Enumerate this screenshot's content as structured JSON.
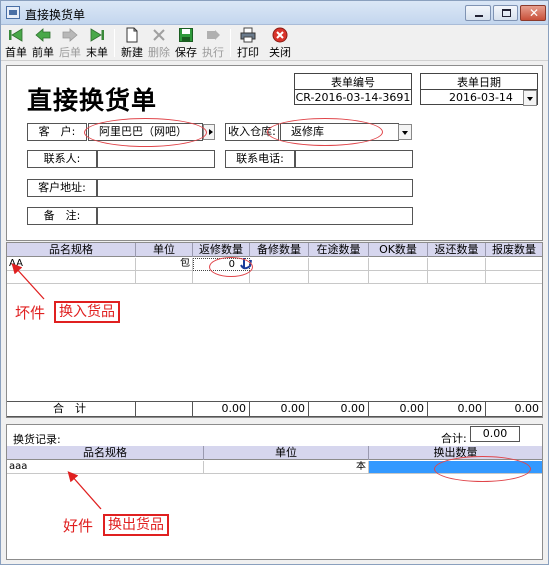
{
  "window": {
    "title": "直接换货单"
  },
  "toolbar": {
    "items": [
      {
        "label": "首单",
        "icon": "first-record-icon",
        "enabled": true
      },
      {
        "label": "前单",
        "icon": "previous-record-icon",
        "enabled": true
      },
      {
        "label": "后单",
        "icon": "next-record-icon",
        "enabled": false
      },
      {
        "label": "末单",
        "icon": "last-record-icon",
        "enabled": true
      },
      {
        "label": "新建",
        "icon": "new-document-icon",
        "enabled": true
      },
      {
        "label": "删除",
        "icon": "delete-icon",
        "enabled": false
      },
      {
        "label": "保存",
        "icon": "save-icon",
        "enabled": true
      },
      {
        "label": "执行",
        "icon": "execute-icon",
        "enabled": false
      },
      {
        "label": "打印",
        "icon": "print-icon",
        "enabled": true
      },
      {
        "label": "关闭",
        "icon": "close-icon",
        "enabled": true
      }
    ]
  },
  "doc": {
    "heading": "直接换货单",
    "number_label": "表单编号",
    "number_value": "CR-2016-03-14-3691",
    "date_label": "表单日期",
    "date_value": "2016-03-14"
  },
  "form": {
    "customer_label": "客　户:",
    "customer_value": "阿里巴巴（网吧）",
    "warehouse_label": "收入仓库:",
    "warehouse_value": "返修库",
    "contact_label": "联系人:",
    "contact_value": "",
    "phone_label": "联系电话:",
    "phone_value": "",
    "address_label": "客户地址:",
    "address_value": "",
    "remark_label": "备　注:",
    "remark_value": ""
  },
  "in_grid": {
    "columns": [
      "品名规格",
      "单位",
      "返修数量",
      "备修数量",
      "在途数量",
      "OK数量",
      "返还数量",
      "报废数量"
    ],
    "rows": [
      {
        "name": "AA",
        "unit": "包",
        "repair_qty": "0"
      }
    ],
    "totals_label": "合　计",
    "totals": [
      "0.00",
      "0.00",
      "0.00",
      "0.00",
      "0.00",
      "0.00"
    ]
  },
  "record": {
    "label": "换货记录:",
    "total_label": "合计:",
    "total_value": "0.00",
    "columns": [
      "品名规格",
      "单位",
      "换出数量"
    ],
    "rows": [
      {
        "name": "aaa",
        "unit": "本",
        "qty": ""
      }
    ]
  },
  "annotations": {
    "bad_prefix": "坏件",
    "bad_box": "换入货品",
    "good_prefix": "好件",
    "good_box": "换出货品",
    "color": "#e02020"
  }
}
